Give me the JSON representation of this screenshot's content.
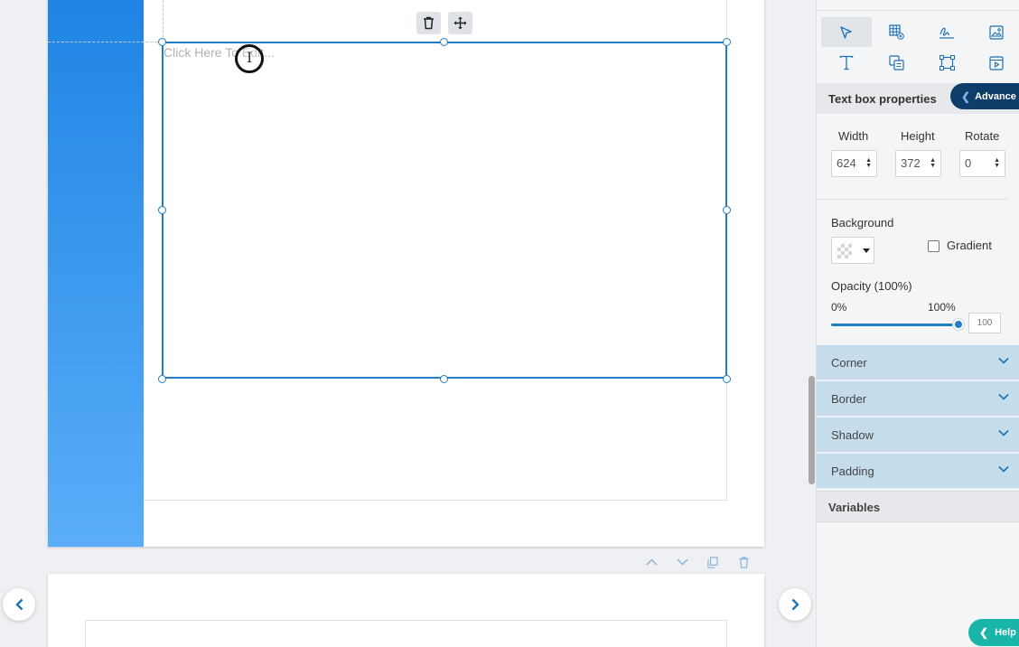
{
  "canvas": {
    "textbox_placeholder": "Click Here To Edit..."
  },
  "toolbar_icons": [
    "select-icon",
    "add-table-icon",
    "signature-icon",
    "image-icon",
    "text-icon",
    "content-block-icon",
    "shape-icon",
    "video-icon"
  ],
  "panel": {
    "header_title": "Text box properties",
    "advance_label": "Advance",
    "width_label": "Width",
    "height_label": "Height",
    "rotate_label": "Rotate",
    "width_value": "624",
    "height_value": "372",
    "rotate_value": "0",
    "background_label": "Background",
    "gradient_label": "Gradient",
    "opacity_label": "Opacity (100%)",
    "opacity_min": "0%",
    "opacity_max": "100%",
    "opacity_value": "100",
    "opacity_level": 1.0,
    "sections": [
      "Corner",
      "Border",
      "Shadow",
      "Padding"
    ],
    "variables_label": "Variables",
    "help_label": "Help"
  },
  "colors": {
    "accent": "#1f7fc4",
    "advance_bg": "#0e3d6a",
    "help_bg": "#1ab5a9",
    "accordion_bg": "#c5dcec"
  }
}
